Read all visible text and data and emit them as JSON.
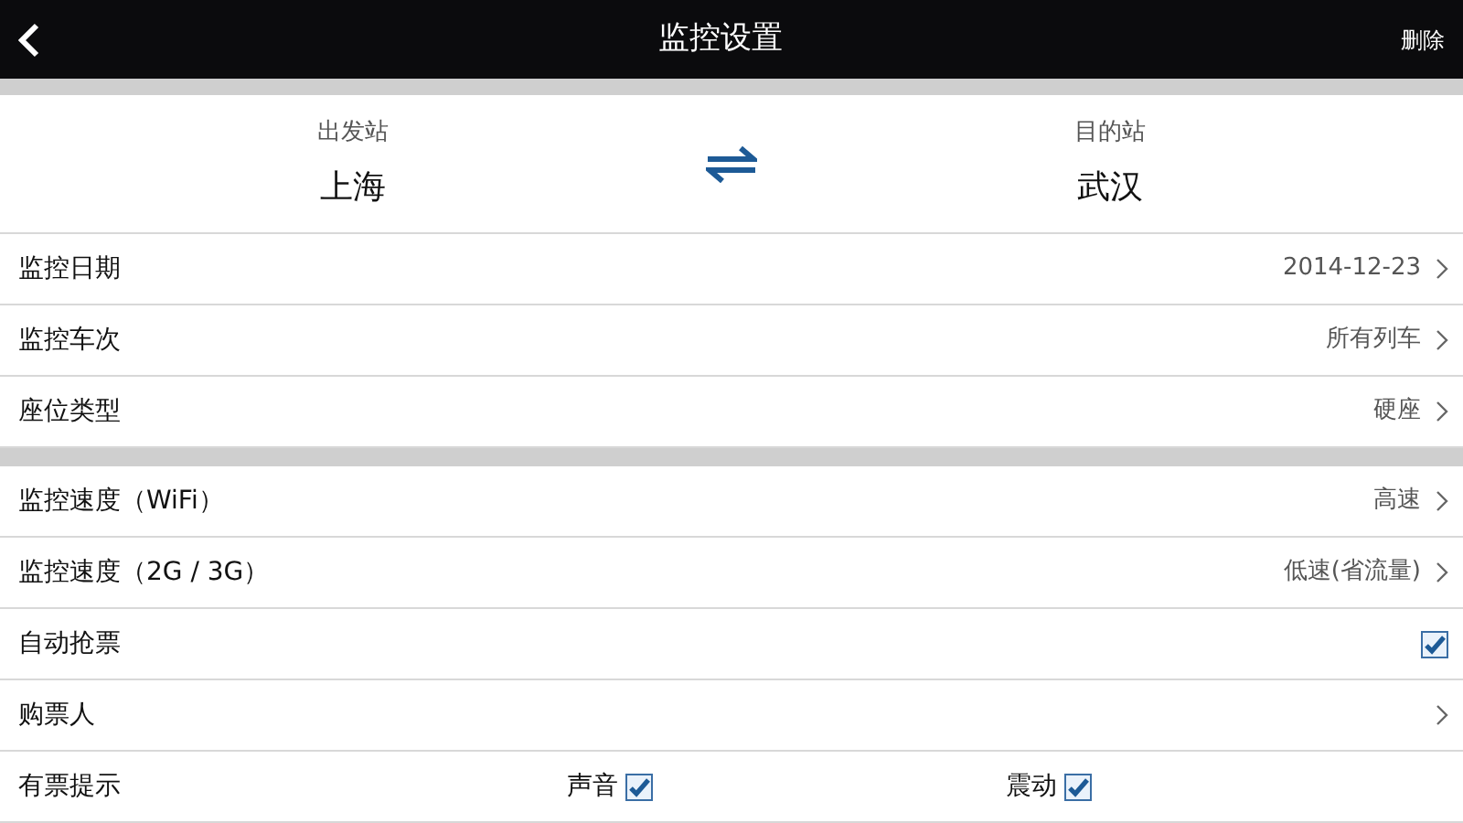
{
  "header": {
    "title": "监控设置",
    "action": "删除"
  },
  "stations": {
    "from_label": "出发站",
    "from": "上海",
    "to_label": "目的站",
    "to": "武汉"
  },
  "groups": [
    {
      "rows": [
        {
          "kind": "select",
          "label": "监控日期",
          "value": "2014-12-23"
        },
        {
          "kind": "select",
          "label": "监控车次",
          "value": "所有列车"
        },
        {
          "kind": "select",
          "label": "座位类型",
          "value": "硬座"
        }
      ]
    },
    {
      "rows": [
        {
          "kind": "select",
          "label": "监控速度（WiFi）",
          "value": "高速"
        },
        {
          "kind": "select",
          "label": "监控速度（2G / 3G）",
          "value": "低速(省流量)"
        },
        {
          "kind": "checkbox",
          "label": "自动抢票",
          "checked": true
        },
        {
          "kind": "link",
          "label": "购票人"
        },
        {
          "kind": "options",
          "label": "有票提示",
          "options": [
            {
              "label": "声音",
              "checked": true
            },
            {
              "label": "震动",
              "checked": true
            }
          ]
        }
      ]
    }
  ]
}
